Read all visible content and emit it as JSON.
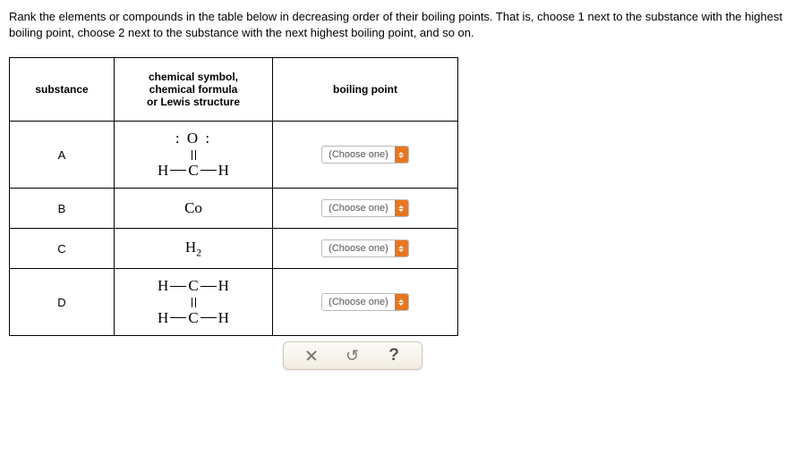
{
  "instructions": "Rank the elements or compounds in the table below in decreasing order of their boiling points. That is, choose 1 next to the substance with the highest boiling point, choose 2 next to the substance with the next highest boiling point, and so on.",
  "headers": {
    "substance": "substance",
    "chem": "chemical symbol,\nchemical formula\nor Lewis structure",
    "bp": "boiling point"
  },
  "rows": {
    "A": {
      "label": "A",
      "dd": "(Choose one)"
    },
    "B": {
      "label": "B",
      "chem": "Co",
      "dd": "(Choose one)"
    },
    "C": {
      "label": "C",
      "chem_base": "H",
      "chem_sub": "2",
      "dd": "(Choose one)"
    },
    "D": {
      "label": "D",
      "dd": "(Choose one)"
    }
  },
  "lewis": {
    "H": "H",
    "C": "C",
    "O_lone": ": O :"
  },
  "toolbar": {
    "help": "?"
  }
}
